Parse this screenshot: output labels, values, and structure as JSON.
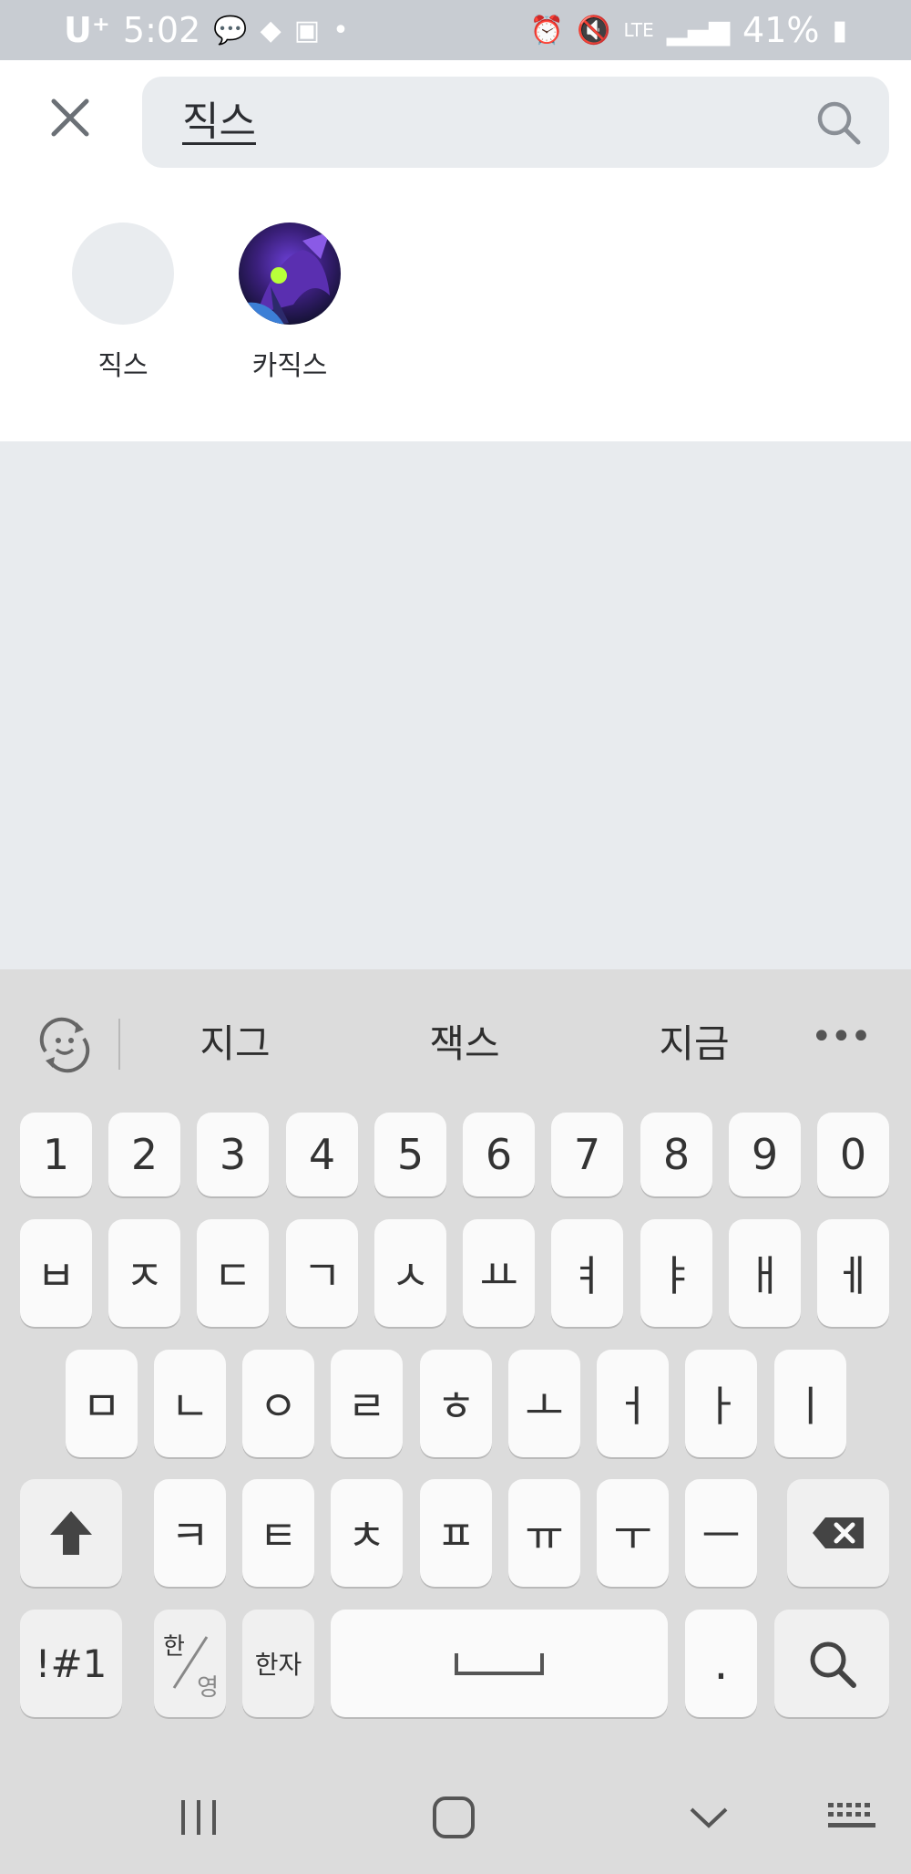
{
  "status_bar": {
    "carrier": "U⁺",
    "time": "5:02",
    "battery": "41%"
  },
  "search": {
    "query": "직스"
  },
  "results": [
    {
      "name": "직스"
    },
    {
      "name": "카직스"
    }
  ],
  "keyboard": {
    "suggestions": [
      "지그",
      "잭스",
      "지금"
    ],
    "number_row": [
      "1",
      "2",
      "3",
      "4",
      "5",
      "6",
      "7",
      "8",
      "9",
      "0"
    ],
    "row1": [
      "ㅂ",
      "ㅈ",
      "ㄷ",
      "ㄱ",
      "ㅅ",
      "ㅛ",
      "ㅕ",
      "ㅑ",
      "ㅐ",
      "ㅔ"
    ],
    "row2": [
      "ㅁ",
      "ㄴ",
      "ㅇ",
      "ㄹ",
      "ㅎ",
      "ㅗ",
      "ㅓ",
      "ㅏ",
      "ㅣ"
    ],
    "row3": [
      "ㅋ",
      "ㅌ",
      "ㅊ",
      "ㅍ",
      "ㅠ",
      "ㅜ",
      "ㅡ"
    ],
    "symbols_label": "!#1",
    "lang_top": "한",
    "lang_bottom": "영",
    "hanja_label": "한자",
    "period_label": "."
  },
  "colors": {
    "status_bar": "#c8ccd2",
    "content_bg": "#e8ebee",
    "keyboard_bg": "#dcdcdc"
  }
}
